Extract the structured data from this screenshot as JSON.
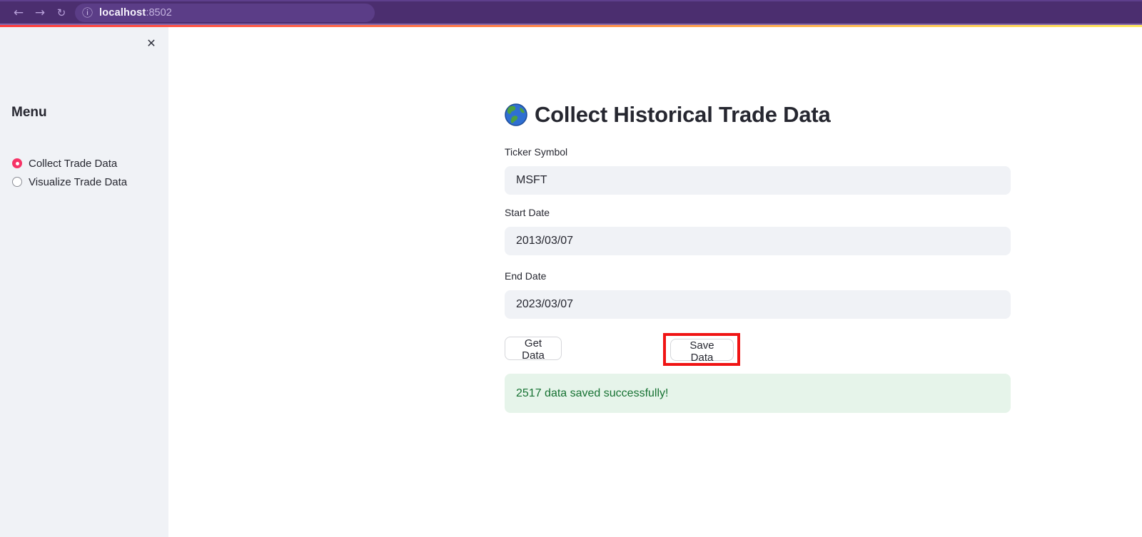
{
  "browser": {
    "url_host": "localhost",
    "url_port": ":8502"
  },
  "icons": {
    "back": "←",
    "forward": "→",
    "reload": "↻",
    "info": "ⓘ",
    "close": "✕"
  },
  "sidebar": {
    "menu_title": "Menu",
    "radio_options": [
      {
        "label": "Collect Trade Data",
        "selected": true
      },
      {
        "label": "Visualize Trade Data",
        "selected": false
      }
    ]
  },
  "main": {
    "title_emoji": "🌎",
    "title": "Collect Historical Trade Data",
    "fields": [
      {
        "label": "Ticker Symbol",
        "value": "MSFT"
      },
      {
        "label": "Start Date",
        "value": "2013/03/07"
      },
      {
        "label": "End Date",
        "value": "2023/03/07"
      }
    ],
    "buttons": [
      {
        "label": "Get Data",
        "highlighted": false
      },
      {
        "label": "Save Data",
        "highlighted": true
      }
    ],
    "success_message": "2517 data saved successfully!"
  },
  "colors": {
    "topbar": "#4b2e6f",
    "address_pill": "#5b3d87",
    "loading_gradient_start": "#ff3b3b",
    "loading_gradient_end": "#ffe95c",
    "sidebar_bg": "#f0f2f6",
    "radio_selected": "#f63366",
    "input_bg": "#f0f2f6",
    "highlight_border": "#f01414",
    "success_bg": "#e6f4ea",
    "success_text": "#177233",
    "text": "#262730"
  }
}
